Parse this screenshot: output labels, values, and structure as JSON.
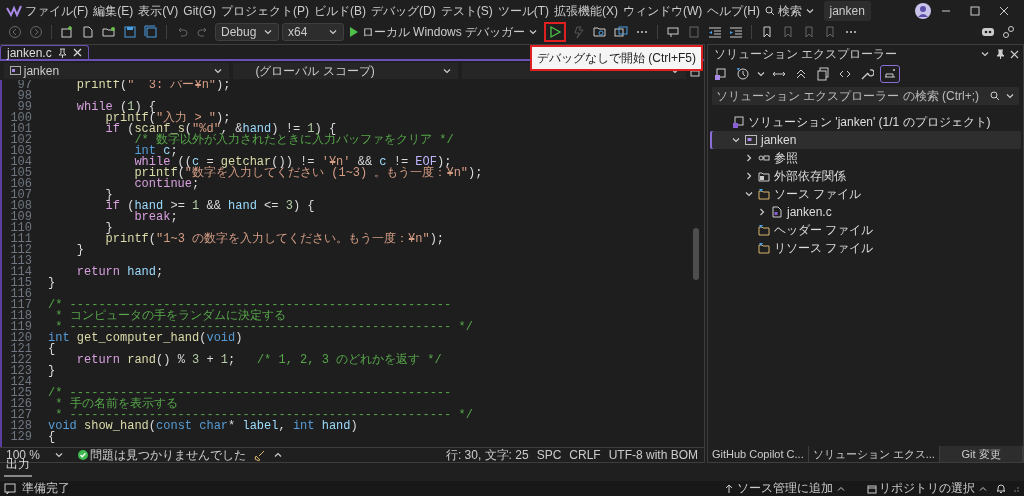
{
  "title_bar": {
    "menus": [
      "ファイル(F)",
      "編集(E)",
      "表示(V)",
      "Git(G)",
      "プロジェクト(P)",
      "ビルド(B)",
      "デバッグ(D)",
      "テスト(S)",
      "ツール(T)",
      "拡張機能(X)",
      "ウィンドウ(W)",
      "ヘルプ(H)"
    ],
    "search": "検索",
    "solution_name": "janken"
  },
  "toolbar": {
    "configuration": "Debug",
    "platform": "x64",
    "debugger": "ローカル Windows デバッガー"
  },
  "tooltip": {
    "text": "デバッグなしで開始 (Ctrl+F5)"
  },
  "editor": {
    "tab": {
      "label": "janken.c",
      "selected": true
    },
    "nav": {
      "project": "janken",
      "scope": "(グローバル スコープ)"
    },
    "lines": [
      {
        "num": "97",
        "tokens": [
          {
            "kind": "fn",
            "text": "    printf"
          },
          {
            "kind": "p",
            "text": "("
          },
          {
            "kind": "str",
            "text": "\"  3: パー¥n\""
          },
          {
            "kind": "p",
            "text": ");"
          }
        ]
      },
      {
        "num": "98"
      },
      {
        "num": "99",
        "tokens": [
          {
            "kind": "ctl",
            "text": "    while"
          },
          {
            "kind": "p",
            "text": " ("
          },
          {
            "kind": "num",
            "text": "1"
          },
          {
            "kind": "p",
            "text": ") {"
          }
        ]
      },
      {
        "num": "100",
        "tokens": [
          {
            "kind": "fn",
            "text": "        printf"
          },
          {
            "kind": "p",
            "text": "("
          },
          {
            "kind": "str",
            "text": "\"入力 > \""
          },
          {
            "kind": "p",
            "text": ");"
          }
        ]
      },
      {
        "num": "101",
        "tokens": [
          {
            "kind": "ctl",
            "text": "        if"
          },
          {
            "kind": "p",
            "text": " ("
          },
          {
            "kind": "fn",
            "text": "scanf_s"
          },
          {
            "kind": "p",
            "text": "("
          },
          {
            "kind": "str",
            "text": "\"%d\""
          },
          {
            "kind": "p",
            "text": ", &"
          },
          {
            "kind": "var",
            "text": "hand"
          },
          {
            "kind": "p",
            "text": ") != "
          },
          {
            "kind": "num",
            "text": "1"
          },
          {
            "kind": "p",
            "text": ") {"
          }
        ]
      },
      {
        "num": "102",
        "tokens": [
          {
            "kind": "cmt",
            "text": "            /* 数字以外が入力されたときに入力バッファをクリア */"
          }
        ]
      },
      {
        "num": "103",
        "tokens": [
          {
            "kind": "kw",
            "text": "            int"
          },
          {
            "kind": "var",
            "text": " c"
          },
          {
            "kind": "p",
            "text": ";"
          }
        ]
      },
      {
        "num": "104",
        "tokens": [
          {
            "kind": "ctl",
            "text": "            while"
          },
          {
            "kind": "p",
            "text": " (("
          },
          {
            "kind": "var",
            "text": "c"
          },
          {
            "kind": "p",
            "text": " = "
          },
          {
            "kind": "fn",
            "text": "getchar"
          },
          {
            "kind": "p",
            "text": "()) != "
          },
          {
            "kind": "str",
            "text": "'¥n'"
          },
          {
            "kind": "p",
            "text": " && "
          },
          {
            "kind": "var",
            "text": "c"
          },
          {
            "kind": "p",
            "text": " != "
          },
          {
            "kind": "mac",
            "text": "EOF"
          },
          {
            "kind": "p",
            "text": ");"
          }
        ]
      },
      {
        "num": "105",
        "tokens": [
          {
            "kind": "fn",
            "text": "            printf"
          },
          {
            "kind": "p",
            "text": "("
          },
          {
            "kind": "str",
            "text": "\"数字を入力してください (1~3) 。もう一度：¥n\""
          },
          {
            "kind": "p",
            "text": ");"
          }
        ]
      },
      {
        "num": "106",
        "tokens": [
          {
            "kind": "ctl",
            "text": "            continue"
          },
          {
            "kind": "p",
            "text": ";"
          }
        ]
      },
      {
        "num": "107",
        "tokens": [
          {
            "kind": "p",
            "text": "        }"
          }
        ]
      },
      {
        "num": "108",
        "tokens": [
          {
            "kind": "ctl",
            "text": "        if"
          },
          {
            "kind": "p",
            "text": " ("
          },
          {
            "kind": "var",
            "text": "hand"
          },
          {
            "kind": "p",
            "text": " >= "
          },
          {
            "kind": "num",
            "text": "1"
          },
          {
            "kind": "p",
            "text": " && "
          },
          {
            "kind": "var",
            "text": "hand"
          },
          {
            "kind": "p",
            "text": " <= "
          },
          {
            "kind": "num",
            "text": "3"
          },
          {
            "kind": "p",
            "text": ") {"
          }
        ]
      },
      {
        "num": "109",
        "tokens": [
          {
            "kind": "ctl",
            "text": "            break"
          },
          {
            "kind": "p",
            "text": ";"
          }
        ]
      },
      {
        "num": "110",
        "tokens": [
          {
            "kind": "p",
            "text": "        }"
          }
        ]
      },
      {
        "num": "111",
        "tokens": [
          {
            "kind": "fn",
            "text": "        printf"
          },
          {
            "kind": "p",
            "text": "("
          },
          {
            "kind": "str",
            "text": "\"1~3 の数字を入力してください。もう一度：¥n\""
          },
          {
            "kind": "p",
            "text": ");"
          }
        ]
      },
      {
        "num": "112",
        "tokens": [
          {
            "kind": "p",
            "text": "    }"
          }
        ]
      },
      {
        "num": "113"
      },
      {
        "num": "114",
        "tokens": [
          {
            "kind": "ctl",
            "text": "    return"
          },
          {
            "kind": "var",
            "text": " hand"
          },
          {
            "kind": "p",
            "text": ";"
          }
        ]
      },
      {
        "num": "115",
        "tokens": [
          {
            "kind": "p",
            "text": "}"
          }
        ]
      },
      {
        "num": "116"
      },
      {
        "num": "117",
        "tokens": [
          {
            "kind": "cmt",
            "text": "/* -----------------------------------------------------"
          }
        ]
      },
      {
        "num": "118",
        "tokens": [
          {
            "kind": "cmt",
            "text": " * コンピュータの手をランダムに決定する"
          }
        ]
      },
      {
        "num": "119",
        "tokens": [
          {
            "kind": "cmt",
            "text": " * ----------------------------------------------------- */"
          }
        ]
      },
      {
        "num": "120",
        "tokens": [
          {
            "kind": "kw",
            "text": "int"
          },
          {
            "kind": "fn",
            "text": " get_computer_hand"
          },
          {
            "kind": "p",
            "text": "("
          },
          {
            "kind": "kw",
            "text": "void"
          },
          {
            "kind": "p",
            "text": ")"
          }
        ]
      },
      {
        "num": "121",
        "tokens": [
          {
            "kind": "p",
            "text": "{"
          }
        ]
      },
      {
        "num": "122",
        "tokens": [
          {
            "kind": "ctl",
            "text": "    return"
          },
          {
            "kind": "fn",
            "text": " rand"
          },
          {
            "kind": "p",
            "text": "() % "
          },
          {
            "kind": "num",
            "text": "3"
          },
          {
            "kind": "p",
            "text": " + "
          },
          {
            "kind": "num",
            "text": "1"
          },
          {
            "kind": "p",
            "text": ";   "
          },
          {
            "kind": "cmt",
            "text": "/* 1, 2, 3 のどれかを返す */"
          }
        ]
      },
      {
        "num": "123",
        "tokens": [
          {
            "kind": "p",
            "text": "}"
          }
        ]
      },
      {
        "num": "124"
      },
      {
        "num": "125",
        "tokens": [
          {
            "kind": "cmt",
            "text": "/* -----------------------------------------------------"
          }
        ]
      },
      {
        "num": "126",
        "tokens": [
          {
            "kind": "cmt",
            "text": " * 手の名前を表示する"
          }
        ]
      },
      {
        "num": "127",
        "tokens": [
          {
            "kind": "cmt",
            "text": " * ----------------------------------------------------- */"
          }
        ]
      },
      {
        "num": "128",
        "tokens": [
          {
            "kind": "kw",
            "text": "void"
          },
          {
            "kind": "fn",
            "text": " show_hand"
          },
          {
            "kind": "p",
            "text": "("
          },
          {
            "kind": "kw",
            "text": "const"
          },
          {
            "kind": "kw",
            "text": " char"
          },
          {
            "kind": "p",
            "text": "* "
          },
          {
            "kind": "var",
            "text": "label"
          },
          {
            "kind": "p",
            "text": ", "
          },
          {
            "kind": "kw",
            "text": "int"
          },
          {
            "kind": "var",
            "text": " hand"
          },
          {
            "kind": "p",
            "text": ")"
          }
        ]
      },
      {
        "num": "129",
        "tokens": [
          {
            "kind": "p",
            "text": "{"
          }
        ]
      }
    ],
    "status": {
      "zoom": "100 %",
      "issues": "問題は見つかりませんでした",
      "position": "行: 30, 文字: 25",
      "indent": "SPC",
      "line_ending": "CRLF",
      "encoding": "UTF-8 with BOM"
    }
  },
  "solution_explorer": {
    "title": "ソリューション エクスプローラー",
    "search": {
      "placeholder": "ソリューション エクスプローラー の検索 (Ctrl+;)"
    },
    "tree": [
      {
        "label": "ソリューション 'janken' (1/1 のプロジェクト)",
        "kind": "solution",
        "selected": false,
        "children": [
          {
            "label": "janken",
            "kind": "project",
            "expanded": true,
            "selected": true,
            "children": [
              {
                "label": "参照",
                "kind": "reference",
                "expanded": false,
                "selected": false
              },
              {
                "label": "外部依存関係",
                "kind": "dependency",
                "expanded": false,
                "selected": false
              },
              {
                "label": "ソース ファイル",
                "kind": "folder",
                "expanded": true,
                "selected": false,
                "children": [
                  {
                    "label": "janken.c",
                    "kind": "file",
                    "expanded": false,
                    "selected": false
                  }
                ]
              },
              {
                "label": "ヘッダー ファイル",
                "kind": "folder",
                "selected": false
              },
              {
                "label": "リソース ファイル",
                "kind": "folder",
                "selected": false
              }
            ]
          }
        ]
      }
    ],
    "tabs": [
      {
        "label": "GitHub Copilot C...",
        "selected": false
      },
      {
        "label": "ソリューション エクス...",
        "selected": false
      },
      {
        "label": "Git 変更",
        "selected": true
      }
    ]
  },
  "output_panel": {
    "tab": "出力"
  },
  "status_bar": {
    "message": "準備完了",
    "add_to_source_control": "ソース管理に追加",
    "select_repository": "リポジトリの選択"
  }
}
